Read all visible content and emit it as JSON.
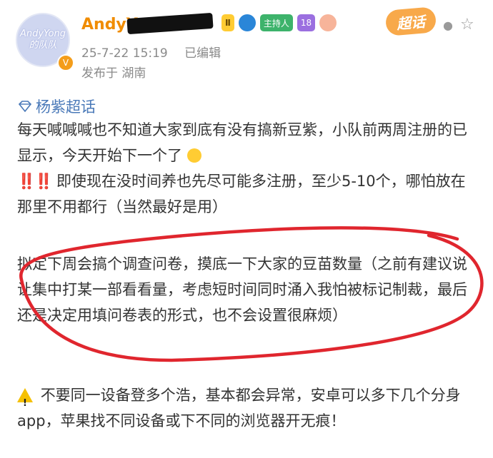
{
  "user": {
    "avatar_lines": [
      "AndyYong",
      "的队队"
    ],
    "name": "AndyY",
    "badges": [
      "Ⅱ",
      "",
      "主持人",
      "18",
      ""
    ],
    "super_label": "超话"
  },
  "meta": {
    "date": "25-7-22 15:19",
    "edited": "已编辑",
    "location": "发布于 湖南"
  },
  "topic": "杨紫超话",
  "post": {
    "p1": "每天喊喊喊也不知道大家到底有没有搞新豆紫，小队前两周注册的已显示，今天开始下一个了",
    "p2_marks": "‼️‼️",
    "p2": "即使现在没时间养也先尽可能多注册，至少5-10个，哪怕放在那里不用都行（当然最好是用）",
    "p3": "拟定下周会搞个调查问卷，摸底一下大家的豆苗数量（之前有建议说让集中打某一部看看量，考虑短时间同时涌入我怕被标记制裁，最后还是决定用填问卷表的形式，也不会设置很麻烦）",
    "p4": "不要同一设备登多个浩，基本都会异常，安卓可以多下几个分身app，苹果找不同设备或下不同的浏览器开无痕！"
  },
  "colors": {
    "name": "#f08c00",
    "topic": "#4a79b8",
    "highlight_circle": "#e0262e"
  }
}
